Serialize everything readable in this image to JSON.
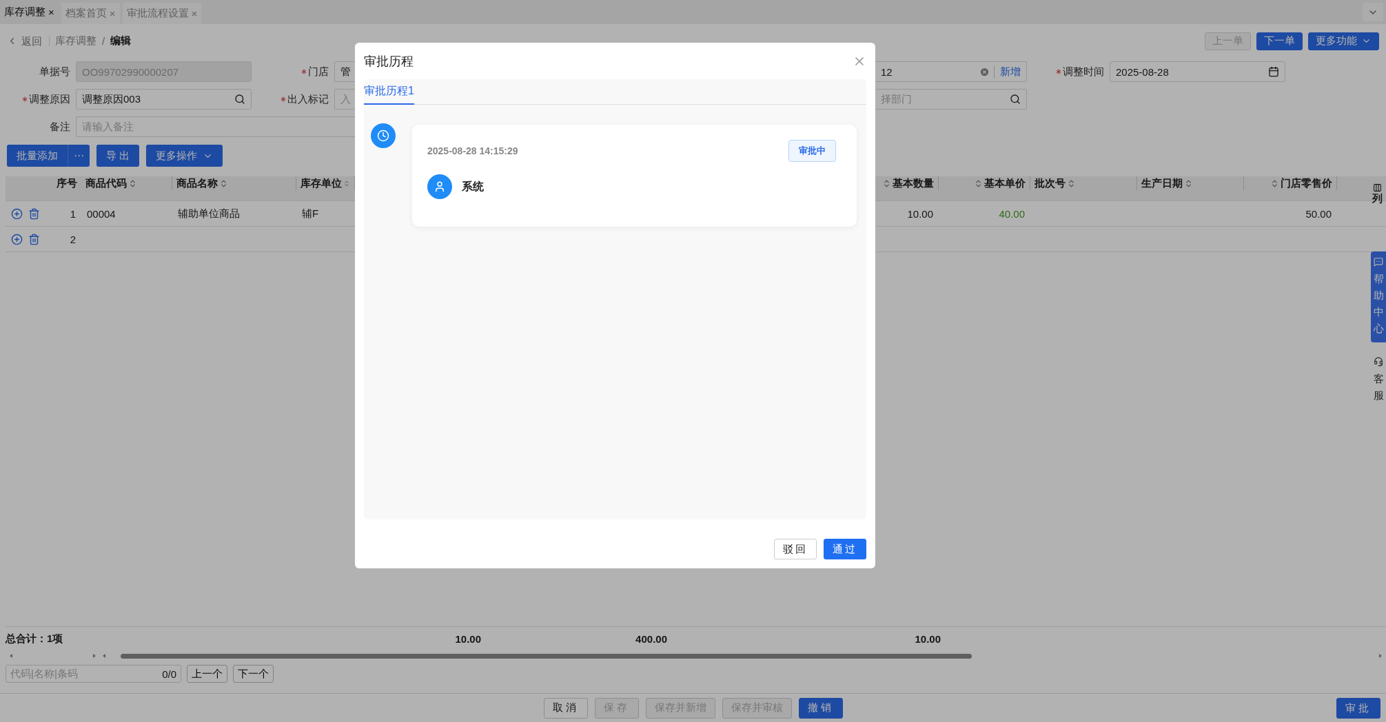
{
  "tabs": [
    {
      "label": "库存调整",
      "selected": true,
      "close": "×"
    },
    {
      "label": "档案首页",
      "selected": false,
      "close": "×"
    },
    {
      "label": "审批流程设置",
      "selected": false,
      "close": "×"
    }
  ],
  "breadcrumb": {
    "back": "返回",
    "items": [
      "库存调整",
      "编辑"
    ],
    "separator": "/"
  },
  "nav_buttons": [
    {
      "label": "上一单",
      "kind": "default",
      "disabled": true
    },
    {
      "label": "下一单",
      "kind": "primary",
      "disabled": false
    },
    {
      "label": "更多功能",
      "kind": "dropdown",
      "disabled": false
    }
  ],
  "form": {
    "rows": [
      {
        "left": [
          {
            "label": "单据号",
            "required": false,
            "value": "OO99702990000207",
            "disabled": true,
            "kind": "text"
          },
          {
            "label": "门店",
            "required": true,
            "value": "管",
            "disabled": false,
            "kind": "text"
          }
        ],
        "right": [
          {
            "value": "12",
            "link": "新增",
            "disabled": false,
            "kind": "clearable"
          },
          {
            "label": "调整时间",
            "required": true,
            "value": "2025-08-28",
            "disabled": false,
            "kind": "date"
          }
        ]
      },
      {
        "left": [
          {
            "label": "调整原因",
            "required": true,
            "value": "调整原因003",
            "disabled": false,
            "kind": "search"
          },
          {
            "label": "出入标记",
            "required": true,
            "placeholder": "入",
            "disabled": false,
            "kind": "text"
          }
        ],
        "right": [
          {
            "placeholder": "择部门",
            "disabled": false,
            "kind": "search"
          }
        ]
      },
      {
        "left": [
          {
            "label": "备注",
            "required": false,
            "placeholder": "请输入备注",
            "disabled": false,
            "kind": "wide"
          }
        ],
        "right": []
      }
    ]
  },
  "toolbar": [
    {
      "label": "批量添加",
      "kind": "split",
      "more": "⋯"
    },
    {
      "label": "导 出",
      "kind": "plain"
    },
    {
      "label": "更多操作",
      "kind": "dropdown"
    }
  ],
  "table": {
    "columns": [
      {
        "label": "序号",
        "kind": "index"
      },
      {
        "label": "商品代码",
        "sortable": true,
        "kind": "text"
      },
      {
        "label": "商品名称",
        "sortable": true,
        "kind": "text"
      },
      {
        "label": "库存单位",
        "sortable": true,
        "kind": "text"
      },
      {
        "label": "基本数量",
        "sortable": true,
        "kind": "number"
      },
      {
        "label": "基本单价",
        "sortable": true,
        "kind": "price"
      },
      {
        "label": "批次号",
        "sortable": true,
        "kind": "text"
      },
      {
        "label": "生产日期",
        "sortable": true,
        "kind": "text"
      },
      {
        "label": "门店零售价",
        "sortable": true,
        "kind": "number"
      }
    ],
    "settings": "列",
    "rows": [
      {
        "no": "1",
        "cells": [
          "00004",
          "辅助单位商品",
          "辅F",
          "10.00",
          "40.00",
          null,
          null,
          "50.00"
        ]
      },
      {
        "no": "2"
      }
    ],
    "totals": {
      "label": "总合计：1项",
      "values": [
        "10.00",
        "400.00",
        "10.00"
      ]
    }
  },
  "locator": {
    "placeholder": "代码|名称|条码",
    "count": "0/0",
    "buttons": [
      "上一个",
      "下一个"
    ]
  },
  "actions": [
    {
      "label": "取消",
      "kind": "default",
      "disabled": false
    },
    {
      "label": "保存",
      "kind": "default",
      "disabled": true
    },
    {
      "label": "保存并新增",
      "kind": "default",
      "disabled": true
    },
    {
      "label": "保存并审核",
      "kind": "default",
      "disabled": true
    },
    {
      "label": "撤销",
      "kind": "primary",
      "disabled": false
    }
  ],
  "approve_button": {
    "label": "审批"
  },
  "side_tabs": [
    {
      "label": "帮助中心",
      "kind": "help"
    },
    {
      "label": "客服",
      "kind": "service"
    }
  ],
  "modal": {
    "title": "审批历程",
    "tabs": [
      {
        "label": "审批历程1",
        "selected": true
      }
    ],
    "timeline": [
      {
        "time": "2025-08-28 14:15:29",
        "status": "审批中",
        "user": "系统"
      }
    ],
    "buttons": [
      {
        "label": "驳回",
        "kind": "default"
      },
      {
        "label": "通过",
        "kind": "primary"
      }
    ]
  }
}
